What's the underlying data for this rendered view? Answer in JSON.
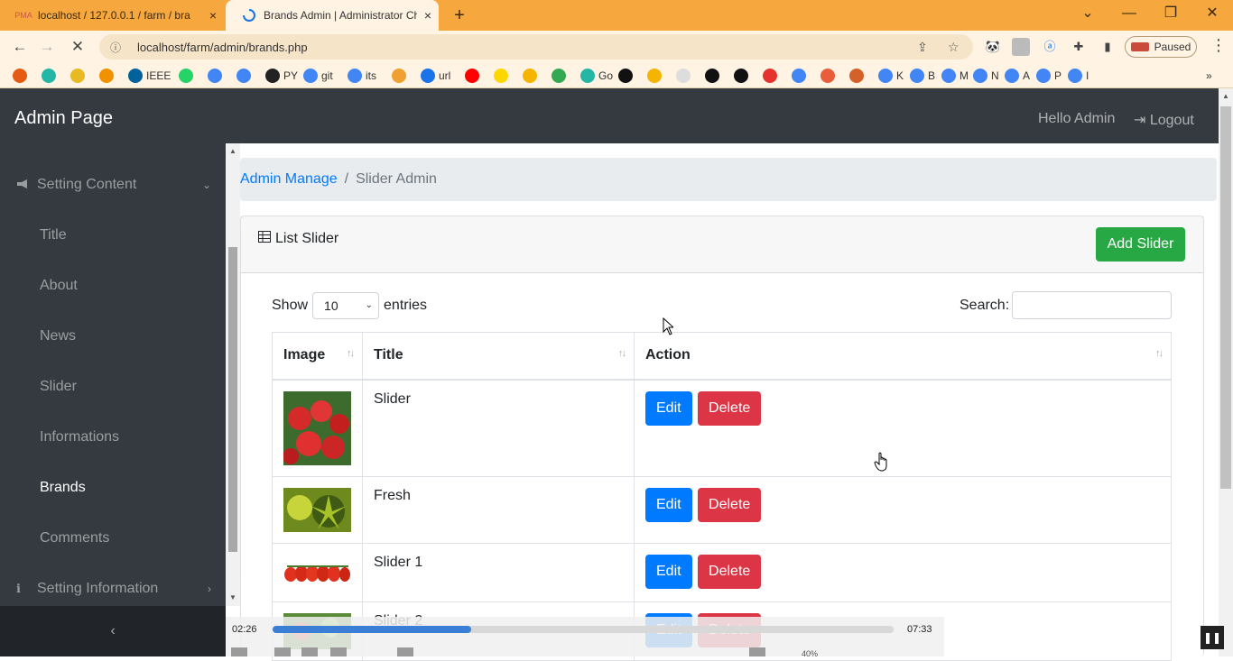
{
  "browser": {
    "tabs": [
      {
        "title": "localhost / 127.0.0.1 / farm / bra",
        "favicon": "phpmyadmin-icon",
        "close": "×"
      },
      {
        "title": "Brands Admin | Administrator Ch",
        "favicon": "loading-spinner-icon",
        "close": "×"
      }
    ],
    "new_tab": "+",
    "window_controls": {
      "list": "⌄",
      "minimize": "—",
      "restore": "❐",
      "close": "✕"
    },
    "nav": {
      "back": "←",
      "forward": "→",
      "reload": "✕"
    },
    "url": "localhost/farm/admin/brands.php",
    "profile_status": "Paused",
    "menu": "⋮",
    "bookmarks": [
      {
        "label": "",
        "color": "#e55b13"
      },
      {
        "label": "",
        "color": "#25b7a5"
      },
      {
        "label": "",
        "color": "#e8b923"
      },
      {
        "label": "",
        "color": "#f29100"
      },
      {
        "label": "IEEE",
        "color": "#00629b"
      },
      {
        "label": "",
        "color": "#25d366"
      },
      {
        "label": "",
        "color": "#4285f4"
      },
      {
        "label": "",
        "color": "#4285f4"
      },
      {
        "label": "PY",
        "color": "#222222"
      },
      {
        "label": "git",
        "color": "#4285f4"
      },
      {
        "label": "its",
        "color": "#4285f4"
      },
      {
        "label": "",
        "color": "#f0a030"
      },
      {
        "label": "url",
        "color": "#1a73e8"
      },
      {
        "label": "",
        "color": "#ff0000"
      },
      {
        "label": "",
        "color": "#ffd700"
      },
      {
        "label": "",
        "color": "#f4b400"
      },
      {
        "label": "",
        "color": "#34a853"
      },
      {
        "label": "Go",
        "color": "#25b7a5"
      },
      {
        "label": "",
        "color": "#111111"
      },
      {
        "label": "",
        "color": "#f4b400"
      },
      {
        "label": "",
        "color": "#dddddd"
      },
      {
        "label": "",
        "color": "#111111"
      },
      {
        "label": "",
        "color": "#111111"
      },
      {
        "label": "",
        "color": "#e5322d"
      },
      {
        "label": "",
        "color": "#4285f4"
      },
      {
        "label": "",
        "color": "#e85d3a"
      },
      {
        "label": "",
        "color": "#d4612a"
      },
      {
        "label": "K",
        "color": "#4285f4"
      },
      {
        "label": "B",
        "color": "#4285f4"
      },
      {
        "label": "M",
        "color": "#4285f4"
      },
      {
        "label": "N",
        "color": "#4285f4"
      },
      {
        "label": "A",
        "color": "#4285f4"
      },
      {
        "label": "P",
        "color": "#4285f4"
      },
      {
        "label": "I",
        "color": "#4285f4"
      }
    ],
    "bookmarks_more": "»"
  },
  "navbar": {
    "brand": "Admin Page",
    "hello": "Hello Admin",
    "logout": "Logout",
    "logout_icon": "⇥"
  },
  "sidebar": {
    "setting_content": "Setting Content",
    "setting_content_icon": "📢",
    "items": [
      "Title",
      "About",
      "News",
      "Slider",
      "Informations",
      "Brands",
      "Comments"
    ],
    "setting_information": "Setting Information",
    "setting_information_icon": "ℹ",
    "collapse": "‹",
    "active": "Brands"
  },
  "breadcrumb": {
    "parent": "Admin Manage",
    "separator": "/",
    "current": "Slider Admin"
  },
  "card": {
    "title": "List Slider",
    "add_button": "Add Slider"
  },
  "datatable": {
    "show_label": "Show",
    "entries_label": "entries",
    "page_length": "10",
    "search_label": "Search:",
    "search_value": "",
    "columns": [
      "Image",
      "Title",
      "Action"
    ],
    "rows": [
      {
        "title": "Slider",
        "image": "radishes"
      },
      {
        "title": "Fresh",
        "image": "green-leaf"
      },
      {
        "title": "Slider 1",
        "image": "cherry-tomatoes"
      },
      {
        "title": "Slider 2",
        "image": "vegetables"
      }
    ],
    "edit_label": "Edit",
    "delete_label": "Delete"
  },
  "player": {
    "elapsed": "02:26",
    "total": "07:33",
    "progress": 0.32,
    "volume": "40%"
  },
  "colors": {
    "navbar": "#343a40",
    "primary": "#007bff",
    "danger": "#dc3545",
    "success": "#28a745",
    "tab_bar": "#f6a73d"
  }
}
